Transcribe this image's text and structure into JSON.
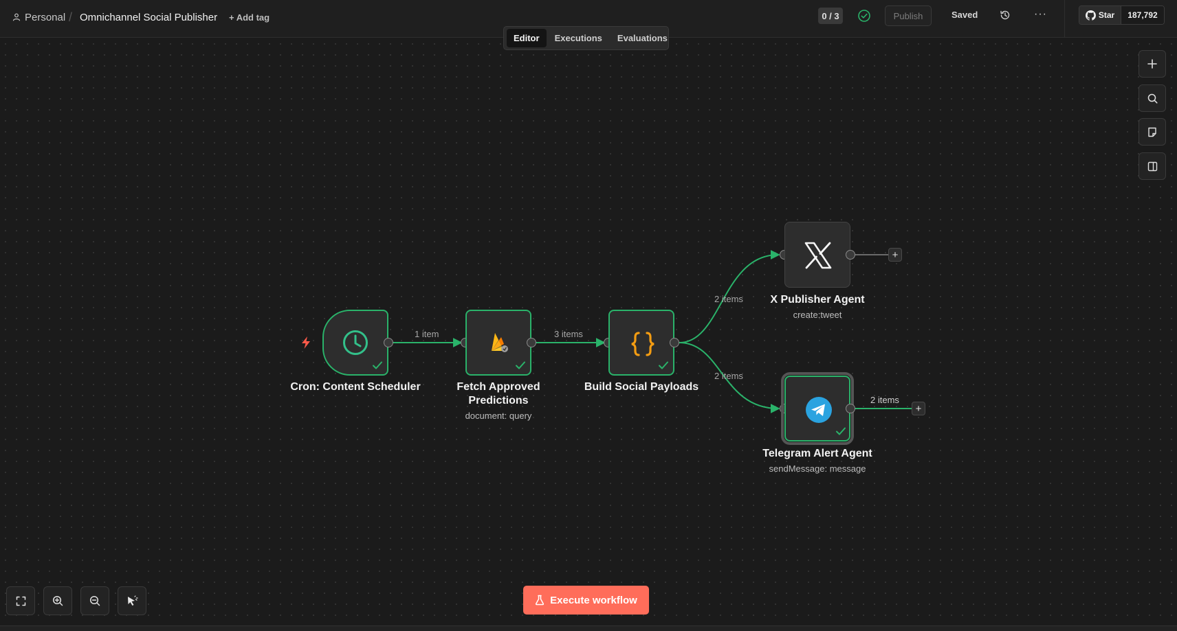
{
  "header": {
    "breadcrumb_project": "Personal",
    "breadcrumb_separator": "/",
    "workflow_title": "Omnichannel Social Publisher",
    "add_tag": "+ Add tag",
    "counter": "0 / 3",
    "publish_label": "Publish",
    "saved_label": "Saved",
    "more_label": "···",
    "github_star": "Star",
    "github_count": "187,792"
  },
  "tabs": [
    {
      "label": "Editor",
      "active": true
    },
    {
      "label": "Executions",
      "active": false
    },
    {
      "label": "Evaluations",
      "active": false
    }
  ],
  "nodes": {
    "cron": {
      "title": "Cron: Content Scheduler"
    },
    "fetch": {
      "title_line1": "Fetch Approved",
      "title_line2": "Predictions",
      "subtitle": "document: query"
    },
    "build": {
      "title": "Build Social Payloads"
    },
    "x": {
      "title": "X Publisher Agent",
      "subtitle": "create:tweet"
    },
    "telegram": {
      "title": "Telegram Alert Agent",
      "subtitle": "sendMessage: message"
    }
  },
  "edges": {
    "cron_fetch": "1 item",
    "fetch_build": "3 items",
    "build_x": "2 items",
    "build_telegram": "2 items",
    "telegram_out": "2 items"
  },
  "execute_button": "Execute workflow",
  "colors": {
    "success": "#2ab36a",
    "execute": "#ff6d5a",
    "trigger_bolt": "#ff5a4a",
    "telegram": "#2aa3e0",
    "code_braces": "#f39c12"
  }
}
